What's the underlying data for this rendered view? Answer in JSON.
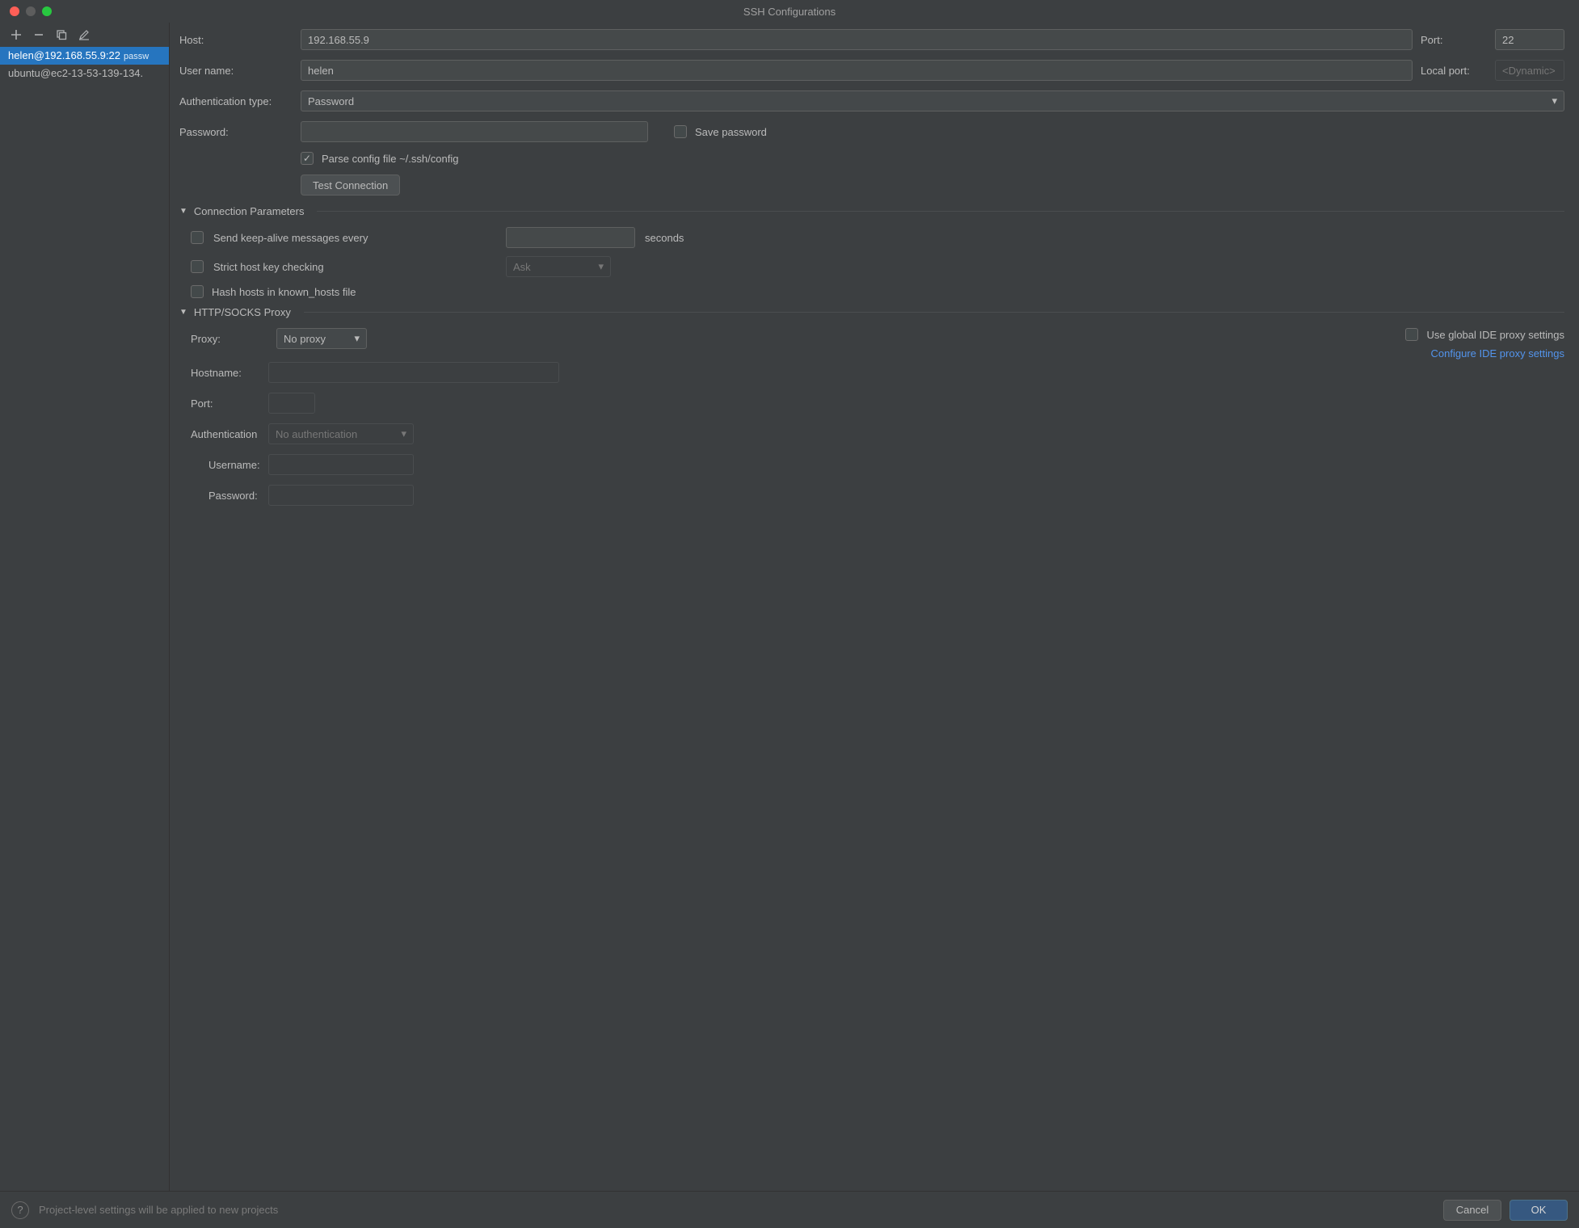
{
  "window": {
    "title": "SSH Configurations"
  },
  "sidebar": {
    "items": [
      {
        "label": "helen@192.168.55.9:22",
        "suffix": "passw",
        "selected": true
      },
      {
        "label": "ubuntu@ec2-13-53-139-134.",
        "suffix": "",
        "selected": false
      }
    ]
  },
  "form": {
    "host_label": "Host:",
    "host_value": "192.168.55.9",
    "port_label": "Port:",
    "port_value": "22",
    "user_label": "User name:",
    "user_value": "helen",
    "localport_label": "Local port:",
    "localport_placeholder": "<Dynamic>",
    "auth_type_label": "Authentication type:",
    "auth_type_value": "Password",
    "password_label": "Password:",
    "password_value": "",
    "save_password_label": "Save password",
    "parse_config_label": "Parse config file ~/.ssh/config",
    "test_connection": "Test Connection"
  },
  "conn": {
    "header": "Connection Parameters",
    "keepalive_label": "Send keep-alive messages every",
    "keepalive_value": "",
    "keepalive_suffix": "seconds",
    "strict_label": "Strict host key checking",
    "strict_value": "Ask",
    "hash_label": "Hash hosts in known_hosts file"
  },
  "proxy": {
    "header": "HTTP/SOCKS Proxy",
    "proxy_label": "Proxy:",
    "proxy_value": "No proxy",
    "hostname_label": "Hostname:",
    "hostname_value": "",
    "port_label": "Port:",
    "port_value": "",
    "auth_label": "Authentication",
    "auth_value": "No authentication",
    "user_label": "Username:",
    "user_value": "",
    "pass_label": "Password:",
    "pass_value": "",
    "use_global_label": "Use global IDE proxy settings",
    "configure_link": "Configure IDE proxy settings"
  },
  "footer": {
    "hint": "Project-level settings will be applied to new projects",
    "cancel": "Cancel",
    "ok": "OK"
  }
}
